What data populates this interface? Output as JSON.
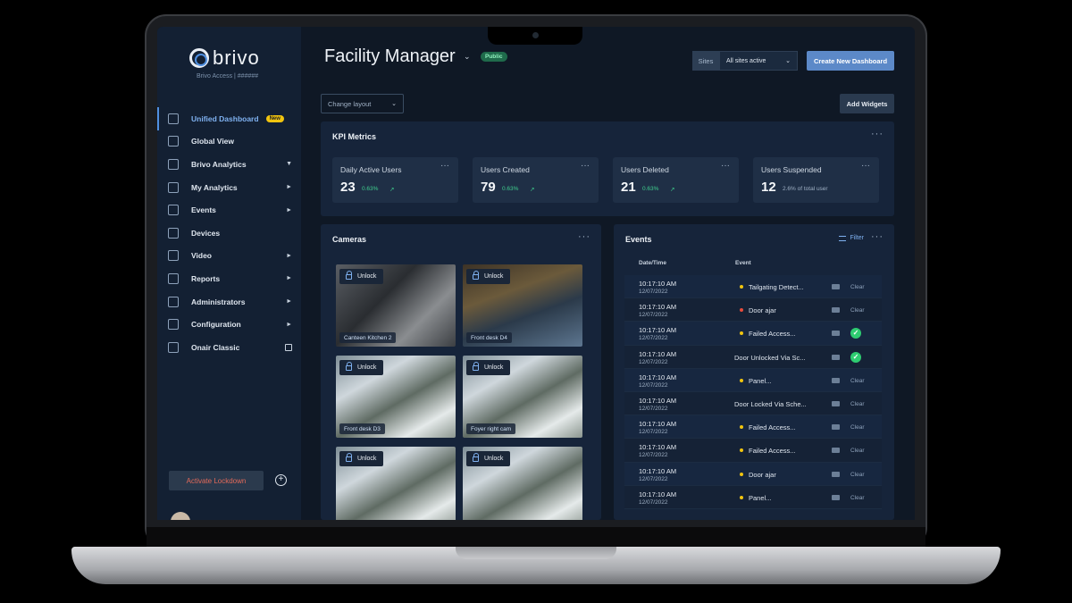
{
  "brand": {
    "name": "brivo",
    "subtitle": "Brivo Access | ######"
  },
  "sidebar": {
    "items": [
      {
        "label": "Unified Dashboard",
        "badge": "New",
        "active": true,
        "icon": "grid-icon"
      },
      {
        "label": "Global View",
        "icon": "globe-icon"
      },
      {
        "label": "Brivo Analytics",
        "arrow": "▼",
        "icon": "analytics-icon"
      },
      {
        "label": "My Analytics",
        "arrow": "►",
        "icon": "chat-icon"
      },
      {
        "label": "Events",
        "arrow": "►",
        "icon": "events-icon"
      },
      {
        "label": "Devices",
        "icon": "devices-icon"
      },
      {
        "label": "Video",
        "arrow": "►",
        "icon": "video-icon"
      },
      {
        "label": "Reports",
        "arrow": "►",
        "icon": "reports-icon"
      },
      {
        "label": "Administrators",
        "arrow": "►",
        "icon": "admin-icon"
      },
      {
        "label": "Configuration",
        "arrow": "►",
        "icon": "config-icon"
      },
      {
        "label": "Onair Classic",
        "external": true,
        "icon": "onair-icon"
      }
    ],
    "lockdown_label": "Activate Lockdown",
    "plus_glyph": "+"
  },
  "header": {
    "title": "Facility Manager",
    "title_chevron": "⌄",
    "visibility_badge": "Public",
    "sites_label": "Sites",
    "sites_value": "All sites active",
    "create_label": "Create New Dashboard",
    "change_layout_placeholder": "Change layout",
    "add_widgets_label": "Add Widgets",
    "dropdown_chevron": "⌄"
  },
  "kpi": {
    "title": "KPI Metrics",
    "dots": "···",
    "cards": [
      {
        "label": "Daily Active Users",
        "value": "23",
        "delta": "0.63%",
        "trend": "↗"
      },
      {
        "label": "Users Created",
        "value": "79",
        "delta": "0.63%",
        "trend": "↗"
      },
      {
        "label": "Users Deleted",
        "value": "21",
        "delta": "0.63%",
        "trend": "↗"
      },
      {
        "label": "Users Suspended",
        "value": "12",
        "delta": "2.6% of total user",
        "trend": ""
      }
    ]
  },
  "cameras": {
    "title": "Cameras",
    "dots": "···",
    "unlock_label": "Unlock",
    "tiles": [
      {
        "name": "Canteen Kitchen 2",
        "scene": "dark"
      },
      {
        "name": "Front desk D4",
        "scene": "night"
      },
      {
        "name": "Front desk D3",
        "scene": "office"
      },
      {
        "name": "Foyer right cam",
        "scene": "office"
      },
      {
        "name": "",
        "scene": "office"
      },
      {
        "name": "",
        "scene": "office"
      }
    ]
  },
  "events": {
    "title": "Events",
    "filter_label": "Filter",
    "dots": "···",
    "col_datetime": "Date/Time",
    "col_event": "Event",
    "clear_label": "Clear",
    "check_glyph": "✓",
    "colors": {
      "yellow": "#f1c40f",
      "red": "#e74c3c",
      "green": "#2ecc71"
    },
    "rows": [
      {
        "time": "10:17:10 AM",
        "date": "12/07/2022",
        "event": "Tailgating Detect...",
        "dot": "yellow",
        "status": "clear"
      },
      {
        "time": "10:17:10 AM",
        "date": "12/07/2022",
        "event": "Door ajar",
        "dot": "red",
        "status": "clear"
      },
      {
        "time": "10:17:10 AM",
        "date": "12/07/2022",
        "event": "Failed Access...",
        "dot": "yellow",
        "status": "check"
      },
      {
        "time": "10:17:10 AM",
        "date": "12/07/2022",
        "event": "Door Unlocked Via Sc...",
        "dot": "",
        "status": "check"
      },
      {
        "time": "10:17:10 AM",
        "date": "12/07/2022",
        "event": "Panel...",
        "dot": "yellow",
        "status": "clear"
      },
      {
        "time": "10:17:10 AM",
        "date": "12/07/2022",
        "event": "Door Locked Via Sche...",
        "dot": "",
        "status": "clear"
      },
      {
        "time": "10:17:10 AM",
        "date": "12/07/2022",
        "event": "Failed Access...",
        "dot": "yellow",
        "status": "clear"
      },
      {
        "time": "10:17:10 AM",
        "date": "12/07/2022",
        "event": "Failed Access...",
        "dot": "yellow",
        "status": "clear"
      },
      {
        "time": "10:17:10 AM",
        "date": "12/07/2022",
        "event": "Door ajar",
        "dot": "yellow",
        "status": "clear"
      },
      {
        "time": "10:17:10 AM",
        "date": "12/07/2022",
        "event": "Panel...",
        "dot": "yellow",
        "status": "clear"
      }
    ]
  }
}
